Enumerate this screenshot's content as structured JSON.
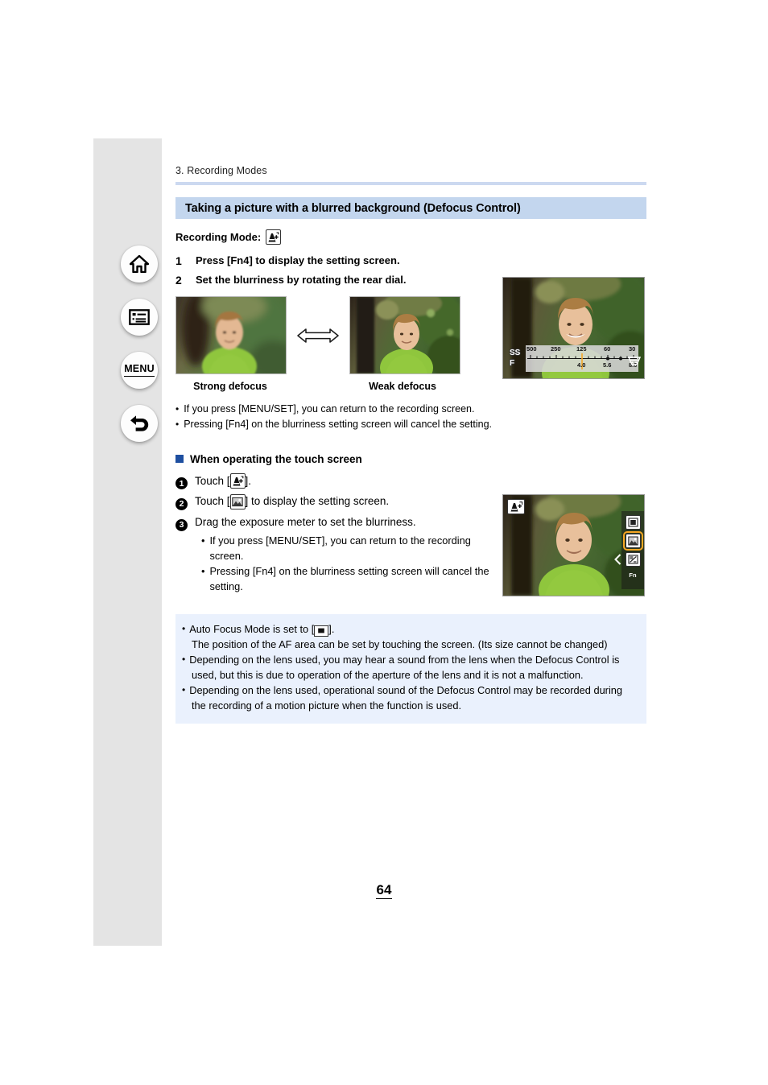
{
  "document": {
    "breadcrumb": "3. Recording Modes",
    "page_number": "64",
    "title": "Taking a picture with a blurred background (Defocus Control)"
  },
  "colors": {
    "title_bar": "#c3d6ee",
    "rule": "#ccd9f0",
    "note_box": "#eaf1fd",
    "sidebar_band": "#e4e4e4",
    "section_square": "#1e4fa0",
    "highlight": "#f5a623"
  },
  "sidebar": {
    "items": [
      {
        "name": "home",
        "label": "",
        "icon": "home-icon"
      },
      {
        "name": "contents",
        "label": "",
        "icon": "list-icon"
      },
      {
        "name": "menu",
        "label": "MENU",
        "icon": "menu-text-icon"
      },
      {
        "name": "back",
        "label": "",
        "icon": "back-arrow-icon"
      }
    ]
  },
  "recording_mode": {
    "label": "Recording Mode:",
    "icon": "ia-plus-mode-icon"
  },
  "steps": [
    {
      "num": "1",
      "text": "Press [Fn4] to display the setting screen."
    },
    {
      "num": "2",
      "text": "Set the blurriness by rotating the rear dial."
    }
  ],
  "photos": {
    "left_caption": "Strong defocus",
    "right_caption": "Weak defocus",
    "arrow": "double-arrow-icon"
  },
  "bullets": [
    "If you press [MENU/SET], you can return to the recording screen.",
    "Pressing [Fn4] on the blurriness setting screen will cancel the setting."
  ],
  "touch_section": {
    "heading": "When operating the touch screen",
    "steps": [
      {
        "num": "1",
        "before": "Touch [",
        "after": "].",
        "icon": "ia-plus-mode-icon"
      },
      {
        "num": "2",
        "before": "Touch [",
        "after": "] to display the setting screen.",
        "icon": "defocus-control-icon"
      },
      {
        "num": "3",
        "before": "Drag the exposure meter to set the blurriness.",
        "after": "",
        "icon": ""
      }
    ],
    "subbullets": [
      "If you press [MENU/SET], you can return to the recording screen.",
      "Pressing [Fn4] on the blurriness setting screen will cancel the setting."
    ]
  },
  "camera_screen_1": {
    "ss_label": "SS",
    "f_label": "F",
    "ss_values": [
      "500",
      "250",
      "125",
      "60",
      "30"
    ],
    "f_values": [
      "4.0",
      "5.6",
      "8.0"
    ],
    "corner_icon": "defocus-meter-icon"
  },
  "camera_screen_2": {
    "mode_icon": "ia-plus-mode-icon",
    "fn_label": "Fn",
    "touch_icons": [
      "monochrome-icon",
      "defocus-control-icon",
      "exposure-comp-icon"
    ],
    "selected_index": 1
  },
  "notes": [
    {
      "lead_before": "Auto Focus Mode is set to [",
      "icon": "af-area-icon",
      "lead_after": "].",
      "continuation": "The position of the AF area can be set by touching the screen. (Its size cannot be changed)"
    },
    {
      "lead_before": "Depending on the lens used, you may hear a sound from the lens when the Defocus Control is",
      "icon": "",
      "lead_after": "",
      "continuation": "used, but this is due to operation of the aperture of the lens and it is not a malfunction."
    },
    {
      "lead_before": "Depending on the lens used, operational sound of the Defocus Control may be recorded during",
      "icon": "",
      "lead_after": "",
      "continuation": "the recording of a motion picture when the function is used."
    }
  ]
}
